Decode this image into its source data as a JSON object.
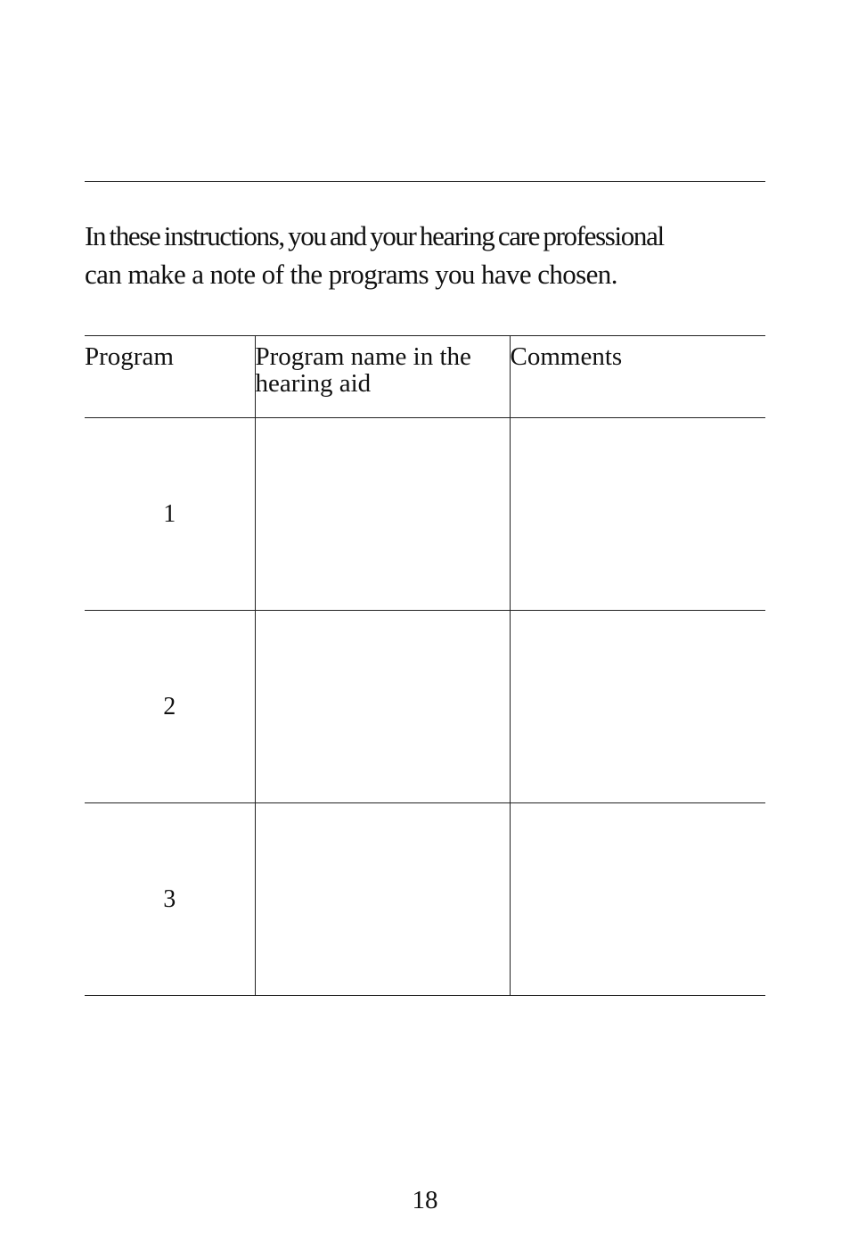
{
  "intro": {
    "line1": "In these instructions, you and your hearing care professional",
    "line2": "can make a note of the programs you have chosen."
  },
  "table": {
    "headers": [
      "Program",
      "Program name in the hearing aid",
      "Comments"
    ],
    "rows": [
      {
        "program": "1",
        "name": "",
        "comments": ""
      },
      {
        "program": "2",
        "name": "",
        "comments": ""
      },
      {
        "program": "3",
        "name": "",
        "comments": ""
      }
    ]
  },
  "page_number": "18"
}
